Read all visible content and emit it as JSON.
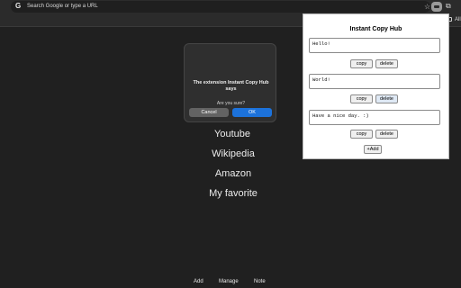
{
  "omnibox": {
    "placeholder": "Search Google or type a URL",
    "g_logo": "G",
    "star_icon": "star-icon",
    "extensions_icon": "puzzle-icon"
  },
  "bookmarks": {
    "all_label": "All"
  },
  "links": [
    "Youtube",
    "Wikipedia",
    "Amazon",
    "My favorite"
  ],
  "bottom_nav": {
    "add": "Add",
    "manage": "Manage",
    "note": "Note"
  },
  "dialog": {
    "title": "The extension Instant Copy Hub says",
    "message": "Are you sure?",
    "cancel_label": "Cancel",
    "ok_label": "OK",
    "ok_color": "#1c72db"
  },
  "popup": {
    "title": "Instant Copy Hub",
    "notes": [
      {
        "text": "Hello!"
      },
      {
        "text": "World!"
      },
      {
        "text": "Have a nice day. :)"
      }
    ],
    "copy_label": "copy",
    "delete_label": "delete",
    "add_label": "+Add"
  }
}
